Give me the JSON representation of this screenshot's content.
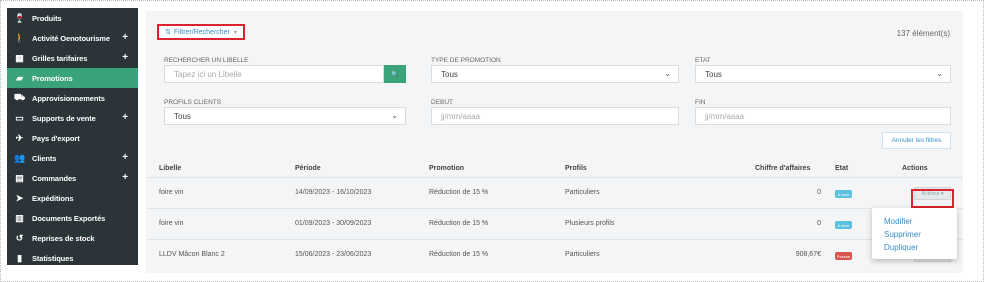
{
  "sidebar": {
    "items": [
      {
        "label": "Produits",
        "icon": "wine-glass-icon",
        "glyph": "🍷",
        "plus": false,
        "active": false
      },
      {
        "label": "Activité Oenotourisme",
        "icon": "person-walking-icon",
        "glyph": "🚶",
        "plus": true,
        "active": false
      },
      {
        "label": "Grilles tarifaires",
        "icon": "price-grid-icon",
        "glyph": "▦",
        "plus": true,
        "active": false
      },
      {
        "label": "Promotions",
        "icon": "tag-icon",
        "glyph": "▰",
        "plus": false,
        "active": true
      },
      {
        "label": "Approvisionnements",
        "icon": "truck-icon",
        "glyph": "⛟",
        "plus": false,
        "active": false
      },
      {
        "label": "Supports de vente",
        "icon": "store-icon",
        "glyph": "▭",
        "plus": true,
        "active": false
      },
      {
        "label": "Pays d'export",
        "icon": "plane-icon",
        "glyph": "✈",
        "plus": false,
        "active": false
      },
      {
        "label": "Clients",
        "icon": "users-icon",
        "glyph": "👥",
        "plus": true,
        "active": false
      },
      {
        "label": "Commandes",
        "icon": "document-icon",
        "glyph": "▤",
        "plus": true,
        "active": false
      },
      {
        "label": "Expéditions",
        "icon": "paper-plane-icon",
        "glyph": "➤",
        "plus": false,
        "active": false
      },
      {
        "label": "Documents Exportés",
        "icon": "export-doc-icon",
        "glyph": "▥",
        "plus": false,
        "active": false
      },
      {
        "label": "Reprises de stock",
        "icon": "undo-icon",
        "glyph": "↺",
        "plus": false,
        "active": false
      },
      {
        "label": "Statistiques",
        "icon": "stats-icon",
        "glyph": "▮",
        "plus": false,
        "active": false
      }
    ],
    "plus_glyph": "+"
  },
  "toolbar": {
    "filter_label": "Filtrer/Rechercher",
    "filter_icon": "⇅",
    "caret": "▾",
    "count": "137 élément(s)"
  },
  "filters": {
    "libelle_label": "RECHERCHER UN LIBELLE",
    "libelle_placeholder": "Tapez ici un Libelle",
    "search_icon": "🔍",
    "type_label": "TYPE DE PROMOTION",
    "type_value": "Tous",
    "etat_label": "ETAT",
    "etat_value": "Tous",
    "profils_label": "PROFILS CLIENTS",
    "profils_value": "Tous",
    "debut_label": "DEBUT",
    "debut_placeholder": "jj/mm/aaaa",
    "fin_label": "FIN",
    "fin_placeholder": "jj/mm/aaaa",
    "chevron": "⌄",
    "reset_label": "Annuler les filtres"
  },
  "table": {
    "headers": {
      "libelle": "Libelle",
      "periode": "Période",
      "promotion": "Promotion",
      "profils": "Profils",
      "ca": "Chiffre d'affaires",
      "etat": "Etat",
      "actions": "Actions"
    },
    "rows": [
      {
        "libelle": "foire vin",
        "periode": "14/09/2023 - 16/10/2023",
        "promotion": "Réduction de 15 %",
        "profils": "Particuliers",
        "ca": "0",
        "etat": "A venir",
        "etat_color": "green",
        "actions": "Actions ▾"
      },
      {
        "libelle": "foire vin",
        "periode": "01/09/2023 - 30/09/2023",
        "promotion": "Réduction de 15 %",
        "profils": "Plusieurs profils",
        "ca": "0",
        "etat": "A venir",
        "etat_color": "green",
        "actions": "Actions ▾"
      },
      {
        "libelle": "LLDV Mâcon Blanc 2",
        "periode": "15/06/2023 - 23/06/2023",
        "promotion": "Réduction de 15 %",
        "profils": "Particuliers",
        "ca": "908,67€",
        "etat": "Passée",
        "etat_color": "red",
        "actions": "Actions ▾"
      }
    ]
  },
  "dropdown": {
    "items": [
      "Modifier",
      "Supprimer",
      "Dupliquer"
    ]
  },
  "colors": {
    "sidebar_bg": "#2b3539",
    "accent_green": "#3aa37a",
    "link_blue": "#3a8ec8",
    "highlight_red": "#d9232e"
  }
}
